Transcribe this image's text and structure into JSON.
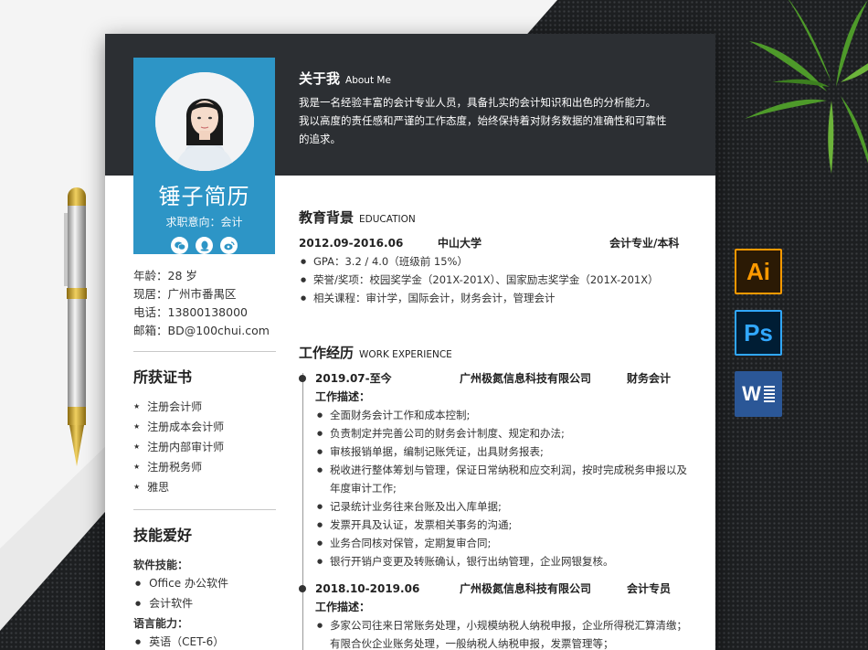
{
  "name": "锤子简历",
  "intent": "求职意向：会计",
  "contact": [
    "年龄：28 岁",
    "现居：广州市番禺区",
    "电话：13800138000",
    "邮箱：BD@100chui.com"
  ],
  "certs": {
    "title": "所获证书",
    "items": [
      "注册会计师",
      "注册成本会计师",
      "注册内部审计师",
      "注册税务师",
      "雅思"
    ]
  },
  "skills": {
    "title": "技能爱好",
    "software_label": "软件技能：",
    "software": [
      "Office 办公软件",
      "会计软件"
    ],
    "language_label": "语言能力：",
    "languages": [
      "英语（CET-6）",
      "粤语"
    ]
  },
  "about": {
    "title": "关于我",
    "title_en": "About Me",
    "lines": [
      "我是一名经验丰富的会计专业人员，具备扎实的会计知识和出色的分析能力。",
      "我以高度的责任感和严谨的工作态度，始终保持着对财务数据的准确性和可靠性",
      "的追求。"
    ]
  },
  "education": {
    "title": "教育背景",
    "title_en": "EDUCATION",
    "period": "2012.09-2016.06",
    "school": "中山大学",
    "major": "会计专业/本科",
    "bullets": [
      "GPA：3.2 / 4.0（班级前 15%）",
      "荣誉/奖项：校园奖学金（201X-201X）、国家励志奖学金（201X-201X）",
      "相关课程：审计学，国际会计，财务会计，管理会计"
    ]
  },
  "work": {
    "title": "工作经历",
    "title_en": "WORK EXPERIENCE",
    "jobs": [
      {
        "period": "2019.07-至今",
        "company": "广州极氮信息科技有限公司",
        "position": "财务会计",
        "desc_label": "工作描述：",
        "bullets": [
          "全面财务会计工作和成本控制;",
          "负责制定并完善公司的财务会计制度、规定和办法;",
          "审核报销单据，编制记账凭证，出具财务报表;",
          "税收进行整体筹划与管理，保证日常纳税和应交利润，按时完成税务申报以及年度审计工作;",
          "记录统计业务往来台账及出入库单据;",
          "发票开具及认证，发票相关事务的沟通;",
          "业务合同核对保管，定期复审合同;",
          "银行开销户变更及转账确认，银行出纳管理，企业网银复核。"
        ]
      },
      {
        "period": "2018.10-2019.06",
        "company": "广州极氮信息科技有限公司",
        "position": "会计专员",
        "desc_label": "工作描述：",
        "bullets": [
          "多家公司往来日常账务处理，小规模纳税人纳税申报，企业所得税汇算清缴；有限合伙企业账务处理，一般纳税人纳税申报，发票管理等；"
        ]
      }
    ]
  },
  "apps": {
    "ai": "Ai",
    "ps": "Ps",
    "word": "W"
  },
  "colors": {
    "accent": "#2d95c6",
    "header": "#2c2f33",
    "background_dark": "#1d1f21"
  }
}
